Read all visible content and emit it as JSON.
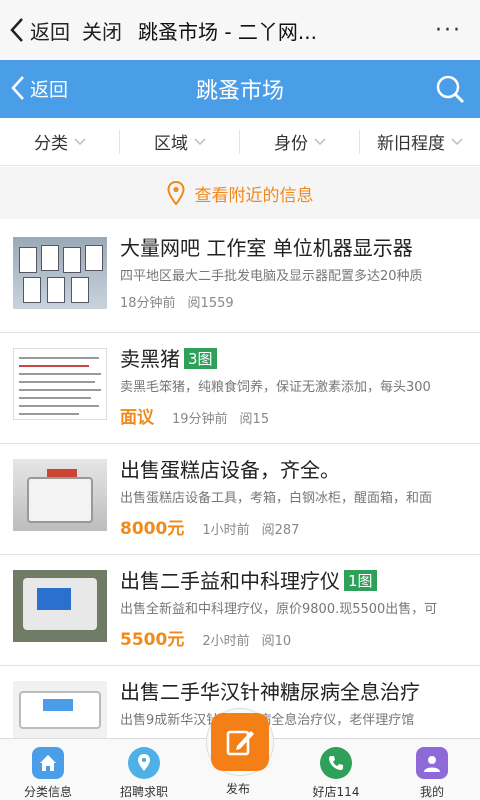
{
  "browser": {
    "back_label": "返回",
    "close_label": "关闭",
    "title": "跳蚤市场 - 二丫网...",
    "more_label": "···"
  },
  "header": {
    "back_label": "返回",
    "title": "跳蚤市场"
  },
  "filters": [
    {
      "label": "分类"
    },
    {
      "label": "区域"
    },
    {
      "label": "身份"
    },
    {
      "label": "新旧程度"
    }
  ],
  "nearby": {
    "label": "查看附近的信息"
  },
  "listings": [
    {
      "title": "大量网吧 工作室 单位机器显示器",
      "badge": "",
      "desc": "四平地区最大二手批发电脑及显示器配置多达20种质",
      "price": "",
      "time": "18分钟前",
      "views": "阅1559"
    },
    {
      "title": "卖黑猪",
      "badge": "3图",
      "desc": "卖黑毛笨猪，纯粮食饲养，保证无激素添加，每头300",
      "price": "面议",
      "time": "19分钟前",
      "views": "阅15"
    },
    {
      "title": "出售蛋糕店设备，齐全。",
      "badge": "",
      "desc": "出售蛋糕店设备工具，考箱，白钢冰柜，醒面箱，和面",
      "price": "8000元",
      "time": "1小时前",
      "views": "阅287"
    },
    {
      "title": "出售二手益和中科理疗仪",
      "badge": "1图",
      "desc": "出售全新益和中科理疗仪，原价9800.现5500出售，可",
      "price": "5500元",
      "time": "2小时前",
      "views": "阅10"
    },
    {
      "title": "出售二手华汉针神糖尿病全息治疗",
      "badge": "",
      "desc": "出售9成新华汉针神糖尿病全息治疗仪，老伴理疗馆",
      "price": "",
      "time": "",
      "views": ""
    }
  ],
  "bottom_nav": {
    "category": {
      "label": "分类信息",
      "icon": "home-icon"
    },
    "jobs": {
      "label": "招聘求职",
      "icon": "location-pin-icon"
    },
    "publish": {
      "label": "发布",
      "icon": "edit-icon"
    },
    "shop": {
      "label": "好店114",
      "icon": "phone-icon"
    },
    "mine": {
      "label": "我的",
      "icon": "user-icon"
    }
  },
  "colors": {
    "header_blue": "#4a9ee8",
    "accent_orange": "#f08a1c",
    "badge_green": "#2ea05a",
    "publish_orange": "#f57f17"
  }
}
